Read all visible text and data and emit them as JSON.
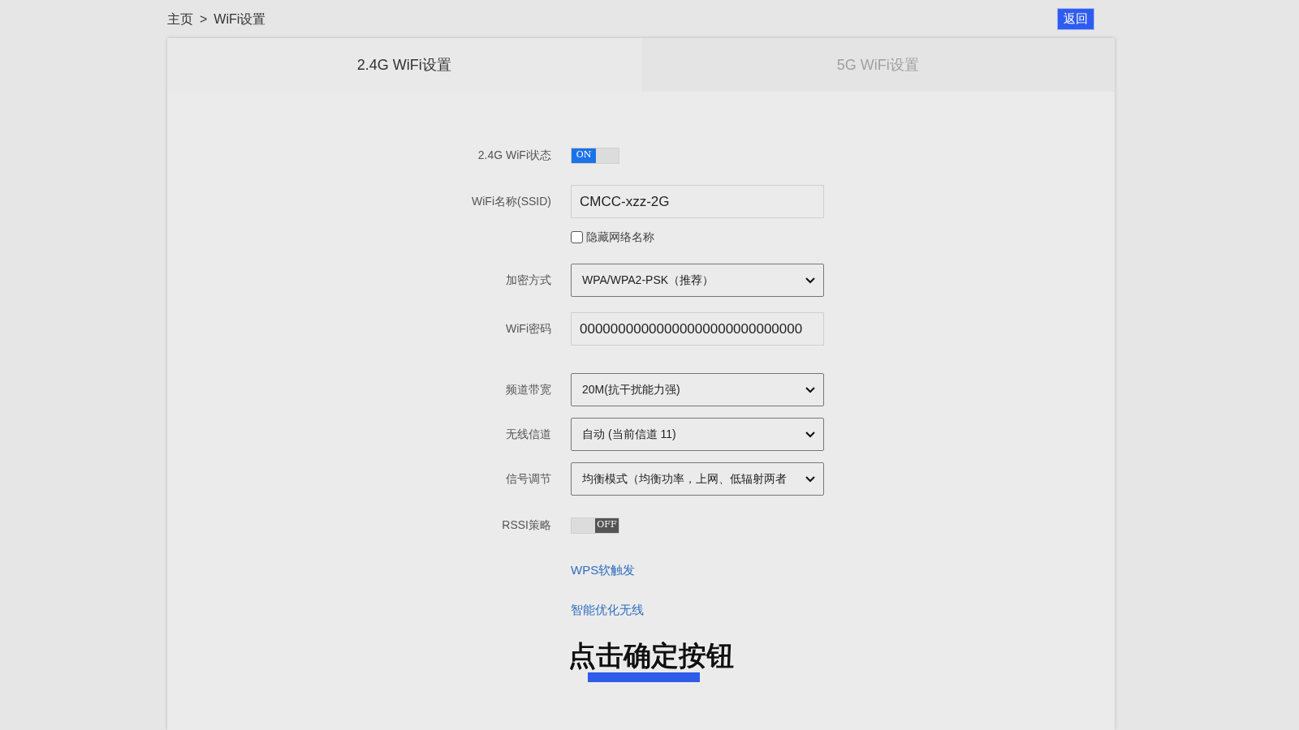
{
  "breadcrumb": {
    "home": "主页",
    "separator": ">",
    "current": "WiFi设置"
  },
  "back_button": "返回",
  "tabs": [
    {
      "label": "2.4G WiFi设置",
      "selected": true
    },
    {
      "label": "5G WiFi设置",
      "selected": false
    }
  ],
  "rows": [
    {
      "kind": "toggle",
      "label": "2.4G WiFi状态",
      "on": true,
      "text": "ON"
    },
    {
      "kind": "input",
      "label": "WiFi名称(SSID)",
      "value": "CMCC-xzz-2G"
    },
    {
      "kind": "checkbox",
      "text": "隐藏网络名称",
      "checked": false
    },
    {
      "kind": "select",
      "label": "加密方式",
      "value": "WPA/WPA2-PSK（推荐）"
    },
    {
      "kind": "input",
      "label": "WiFi密码",
      "value": "00000000000000000000000000000"
    },
    {
      "kind": "select",
      "label": "频道带宽",
      "value": "20M(抗干扰能力强)"
    },
    {
      "kind": "select",
      "label": "无线信道",
      "value": "自动 (当前信道 11)"
    },
    {
      "kind": "select",
      "label": "信号调节",
      "value": "均衡模式（均衡功率，上网、低辐射两者"
    },
    {
      "kind": "toggle",
      "label": "RSSI策略",
      "on": false,
      "text": "OFF"
    },
    {
      "kind": "link",
      "text": "WPS软触发"
    },
    {
      "kind": "link",
      "text": "智能优化无线"
    }
  ],
  "caption": "点击确定按钮"
}
